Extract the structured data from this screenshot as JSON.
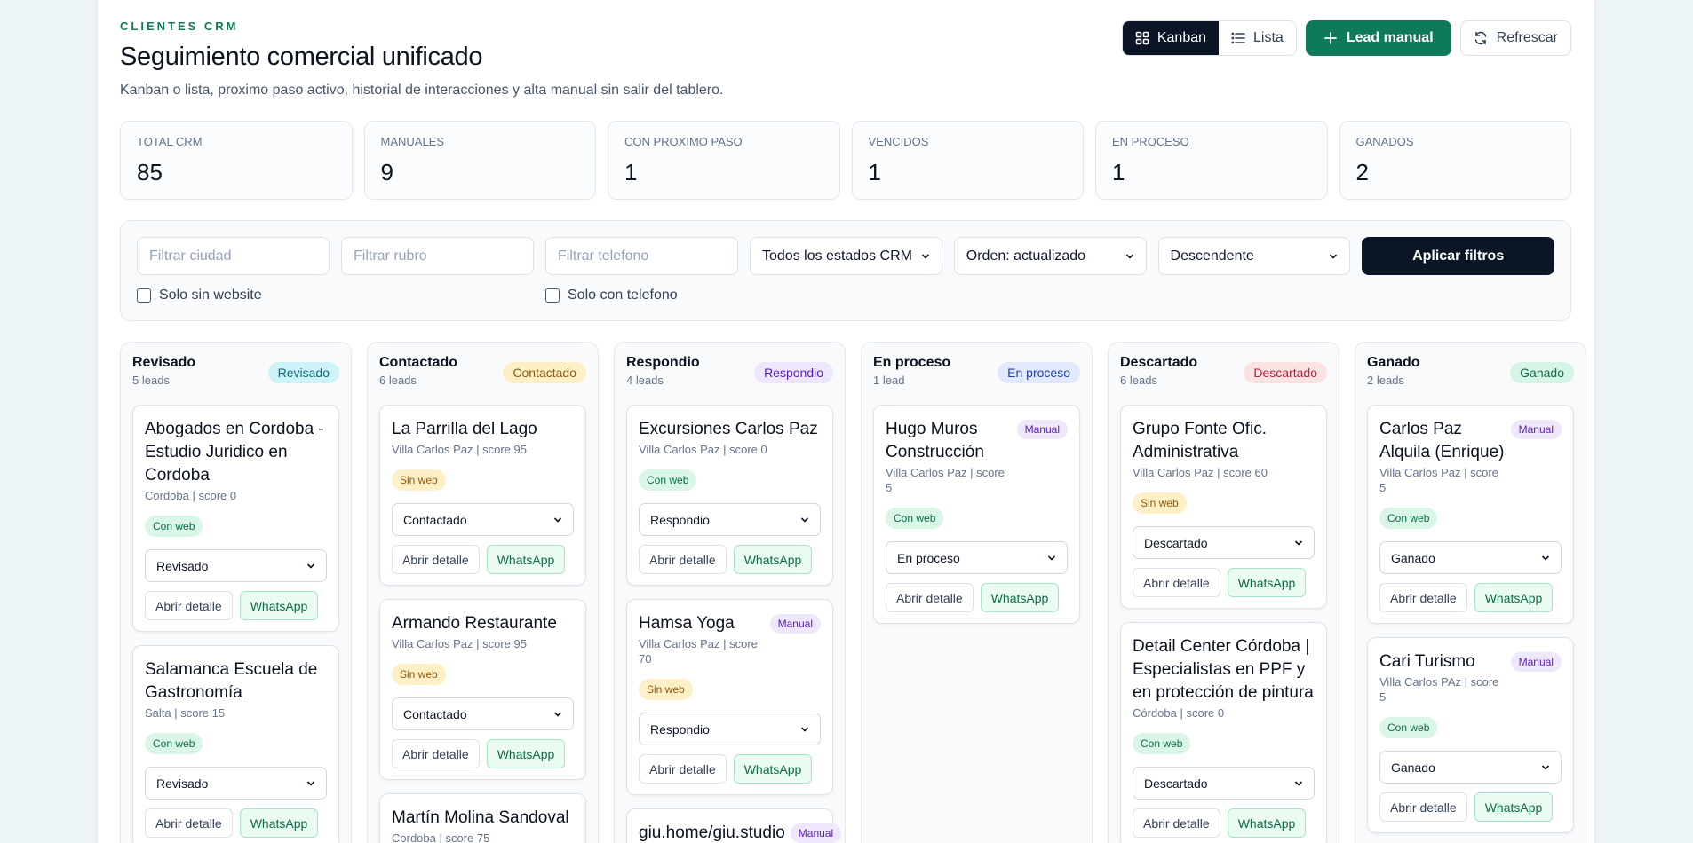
{
  "header": {
    "eyebrow": "CLIENTES CRM",
    "title": "Seguimiento comercial unificado",
    "subtitle": "Kanban o lista, proximo paso activo, historial de interacciones y alta manual sin salir del tablero.",
    "view_kanban": "Kanban",
    "view_list": "Lista",
    "new_lead": "Lead manual",
    "refresh": "Refrescar"
  },
  "stats": [
    {
      "label": "TOTAL CRM",
      "value": "85"
    },
    {
      "label": "MANUALES",
      "value": "9"
    },
    {
      "label": "CON PROXIMO PASO",
      "value": "1"
    },
    {
      "label": "VENCIDOS",
      "value": "1"
    },
    {
      "label": "EN PROCESO",
      "value": "1"
    },
    {
      "label": "GANADOS",
      "value": "2"
    }
  ],
  "filters": {
    "city_placeholder": "Filtrar ciudad",
    "category_placeholder": "Filtrar rubro",
    "phone_placeholder": "Filtrar telefono",
    "status_select": "Todos los estados CRM",
    "order_select": "Orden: actualizado",
    "direction_select": "Descendente",
    "apply": "Aplicar filtros",
    "no_website": "Solo sin website",
    "with_phone": "Solo con telefono"
  },
  "card_actions": {
    "detail": "Abrir detalle",
    "whatsapp": "WhatsApp"
  },
  "columns": [
    {
      "name": "Revisado",
      "count": "5 leads",
      "pill": "Revisado",
      "cards": [
        {
          "name": "Abogados en Cordoba - Estudio Juridico en Cordoba",
          "meta": "Cordoba | score 0",
          "web": "Con web",
          "status": "Revisado",
          "manual": ""
        },
        {
          "name": "Salamanca Escuela de Gastronomía",
          "meta": "Salta | score 15",
          "web": "Con web",
          "status": "Revisado",
          "manual": ""
        }
      ]
    },
    {
      "name": "Contactado",
      "count": "6 leads",
      "pill": "Contactado",
      "cards": [
        {
          "name": "La Parrilla del Lago",
          "meta": "Villa Carlos Paz | score 95",
          "web": "Sin web",
          "status": "Contactado",
          "manual": ""
        },
        {
          "name": "Armando Restaurante",
          "meta": "Villa Carlos Paz | score 95",
          "web": "Sin web",
          "status": "Contactado",
          "manual": ""
        },
        {
          "name": "Martín Molina Sandoval",
          "meta": "Cordoba | score 75",
          "web": "",
          "status": "",
          "manual": ""
        }
      ]
    },
    {
      "name": "Respondio",
      "count": "4 leads",
      "pill": "Respondio",
      "cards": [
        {
          "name": "Excursiones Carlos Paz",
          "meta": "Villa Carlos Paz | score 0",
          "web": "Con web",
          "status": "Respondio",
          "manual": ""
        },
        {
          "name": "Hamsa Yoga",
          "meta": "Villa Carlos Paz | score 70",
          "web": "Sin web",
          "status": "Respondio",
          "manual": "Manual"
        },
        {
          "name": "giu.home/giu.studio",
          "meta": "",
          "web": "",
          "status": "",
          "manual": "Manual"
        }
      ]
    },
    {
      "name": "En proceso",
      "count": "1 lead",
      "pill": "En proceso",
      "cards": [
        {
          "name": "Hugo Muros Construcción",
          "meta": "Villa Carlos Paz | score 5",
          "web": "Con web",
          "status": "En proceso",
          "manual": "Manual"
        }
      ]
    },
    {
      "name": "Descartado",
      "count": "6 leads",
      "pill": "Descartado",
      "cards": [
        {
          "name": "Grupo Fonte Ofic. Administrativa",
          "meta": "Villa Carlos Paz | score 60",
          "web": "Sin web",
          "status": "Descartado",
          "manual": ""
        },
        {
          "name": "Detail Center Córdoba | Especialistas en PPF y en protección de pintura",
          "meta": "Córdoba | score 0",
          "web": "Con web",
          "status": "Descartado",
          "manual": ""
        }
      ]
    },
    {
      "name": "Ganado",
      "count": "2 leads",
      "pill": "Ganado",
      "cards": [
        {
          "name": "Carlos Paz Alquila (Enrique)",
          "meta": "Villa Carlos Paz | score 5",
          "web": "Con web",
          "status": "Ganado",
          "manual": "Manual"
        },
        {
          "name": "Cari Turismo",
          "meta": "Villa Carlos PAz | score 5",
          "web": "Con web",
          "status": "Ganado",
          "manual": "Manual"
        }
      ]
    }
  ]
}
